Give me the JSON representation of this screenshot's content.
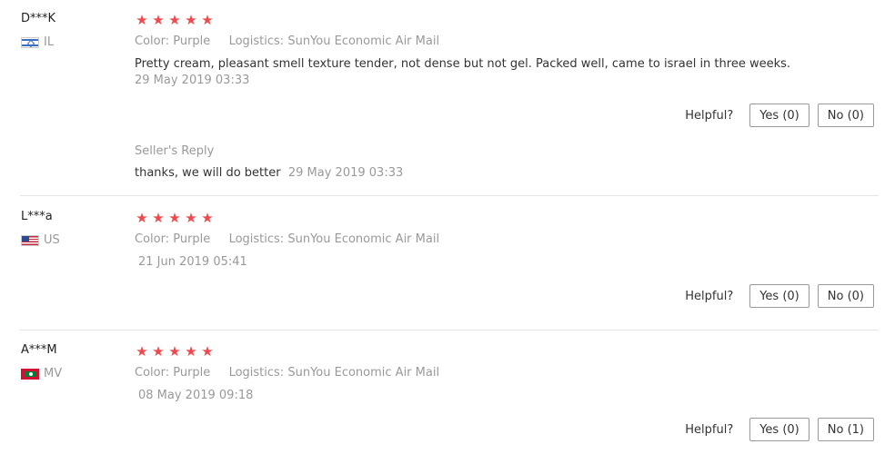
{
  "reviews": [
    {
      "user": "D***K",
      "country": "IL",
      "flag_icon": "israel-flag-icon",
      "rating": 5,
      "color_label": "Color:",
      "color_value": "Purple",
      "logistics_label": "Logistics:",
      "logistics_value": "SunYou Economic Air Mail",
      "text": "Pretty cream, pleasant smell texture tender, not dense but not gel. Packed well, came to israel in three weeks.",
      "date": "29 May 2019 03:33",
      "helpful_label": "Helpful?",
      "yes_label": "Yes (0)",
      "no_label": "No (0)",
      "seller_reply_title": "Seller's Reply",
      "seller_reply_text": "thanks, we will do better",
      "seller_reply_date": "29 May 2019 03:33"
    },
    {
      "user": "L***a",
      "country": "US",
      "flag_icon": "us-flag-icon",
      "rating": 5,
      "color_label": "Color:",
      "color_value": "Purple",
      "logistics_label": "Logistics:",
      "logistics_value": "SunYou Economic Air Mail",
      "date": "21 Jun 2019 05:41",
      "helpful_label": "Helpful?",
      "yes_label": "Yes (0)",
      "no_label": "No (0)"
    },
    {
      "user": "A***M",
      "country": "MV",
      "flag_icon": "maldives-flag-icon",
      "rating": 5,
      "color_label": "Color:",
      "color_value": "Purple",
      "logistics_label": "Logistics:",
      "logistics_value": "SunYou Economic Air Mail",
      "date": "08 May 2019 09:18",
      "helpful_label": "Helpful?",
      "yes_label": "Yes (0)",
      "no_label": "No (1)"
    }
  ],
  "colors": {
    "star": "#f0484c",
    "muted_text": "#999999",
    "body_text": "#333333"
  },
  "icons": {
    "star": "star-icon"
  }
}
